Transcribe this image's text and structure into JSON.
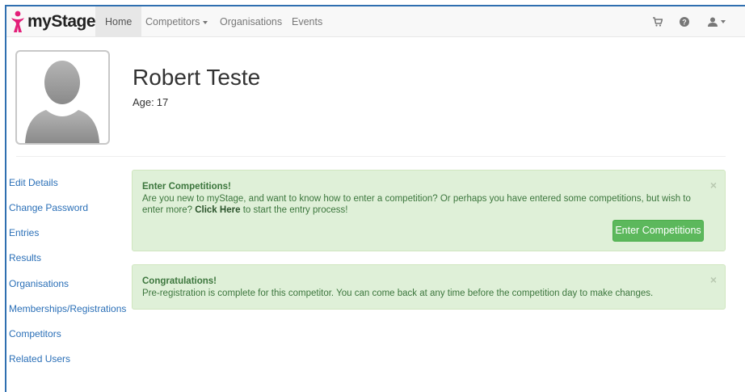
{
  "app": {
    "brand": "myStage",
    "brand_color": "#e31e79"
  },
  "navbar": {
    "items": [
      {
        "label": "Home",
        "active": true
      },
      {
        "label": "Competitors",
        "dropdown": true
      },
      {
        "label": "Organisations"
      },
      {
        "label": "Events"
      }
    ],
    "icons": [
      "cart-icon",
      "help-icon",
      "user-icon"
    ]
  },
  "profile": {
    "name": "Robert Teste",
    "age_label": "Age:",
    "age_value": "17"
  },
  "sidebar": {
    "items": [
      {
        "label": "Edit Details"
      },
      {
        "label": "Change Password"
      },
      {
        "label": "Entries"
      },
      {
        "label": "Results"
      },
      {
        "label": "Organisations"
      },
      {
        "label": "Memberships/Registrations"
      },
      {
        "label": "Competitors"
      },
      {
        "label": "Related Users"
      }
    ]
  },
  "alerts": {
    "enter": {
      "title": "Enter Competitions!",
      "body_before": "Are you new to myStage, and want to know how to enter a competition? Or perhaps you have entered some competitions, but wish to enter more?",
      "link_text": "Click Here",
      "body_after": "to start the entry process!",
      "button_label": "Enter Competitions",
      "close": "×"
    },
    "congrats": {
      "title": "Congratulations!",
      "body": "Pre-registration is complete for this competitor. You can come back at any time before the competition day to make changes.",
      "close": "×"
    }
  },
  "colors": {
    "alert_bg": "#dff0d8",
    "alert_text": "#3c763d",
    "button": "#5cb85c",
    "link": "#2a6fb7"
  }
}
